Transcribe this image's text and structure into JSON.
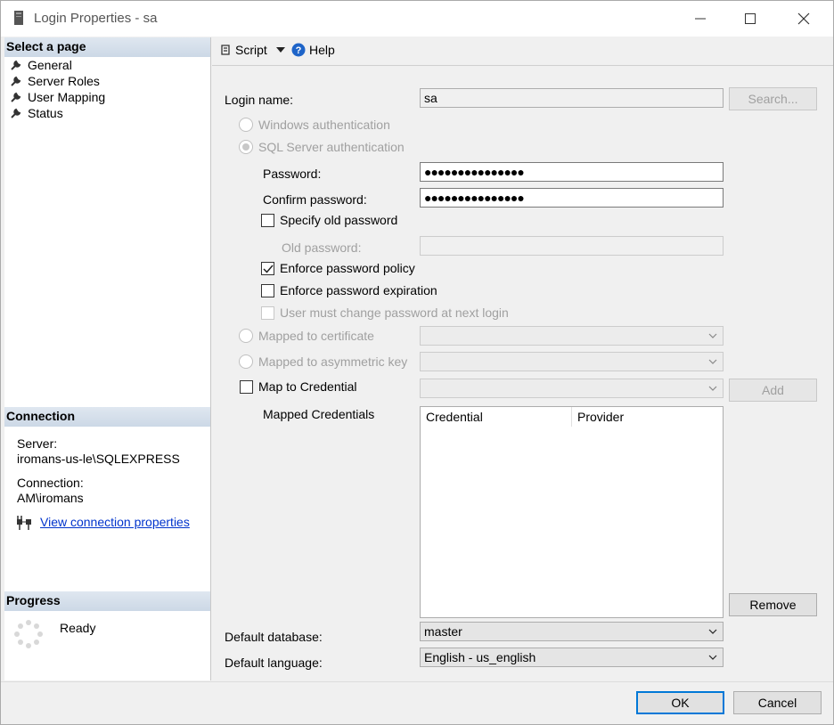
{
  "window": {
    "title": "Login Properties - sa",
    "minimize": "—",
    "maximize": "☐",
    "close": "✕"
  },
  "left": {
    "select_page_header": "Select a page",
    "pages": [
      "General",
      "Server Roles",
      "User Mapping",
      "Status"
    ],
    "connection_header": "Connection",
    "server_label": "Server:",
    "server_value": "iromans-us-le\\SQLEXPRESS",
    "connection_label": "Connection:",
    "connection_value": "AM\\iromans",
    "view_conn_link": "View connection properties",
    "progress_header": "Progress",
    "progress_status": "Ready"
  },
  "toolbar": {
    "script_label": "Script",
    "help_label": "Help"
  },
  "form": {
    "login_name_label": "Login name:",
    "login_name_value": "sa",
    "search_button": "Search...",
    "windows_auth": "Windows authentication",
    "sql_auth": "SQL Server authentication",
    "password_label": "Password:",
    "password_value": "●●●●●●●●●●●●●●●",
    "confirm_password_label": "Confirm password:",
    "confirm_password_value": "●●●●●●●●●●●●●●●",
    "specify_old_password": "Specify old password",
    "old_password_label": "Old password:",
    "enforce_policy": "Enforce password policy",
    "enforce_policy_checked": true,
    "enforce_expiration": "Enforce password expiration",
    "must_change": "User must change password at next login",
    "mapped_certificate": "Mapped to certificate",
    "mapped_asymmetric_key": "Mapped to asymmetric key",
    "map_to_credential": "Map to Credential",
    "add_button": "Add",
    "mapped_credentials_label": "Mapped Credentials",
    "credentials_columns": [
      "Credential",
      "Provider"
    ],
    "remove_button": "Remove",
    "default_database_label": "Default database:",
    "default_database_value": "master",
    "default_language_label": "Default language:",
    "default_language_value": "English - us_english"
  },
  "buttons": {
    "ok": "OK",
    "cancel": "Cancel"
  }
}
